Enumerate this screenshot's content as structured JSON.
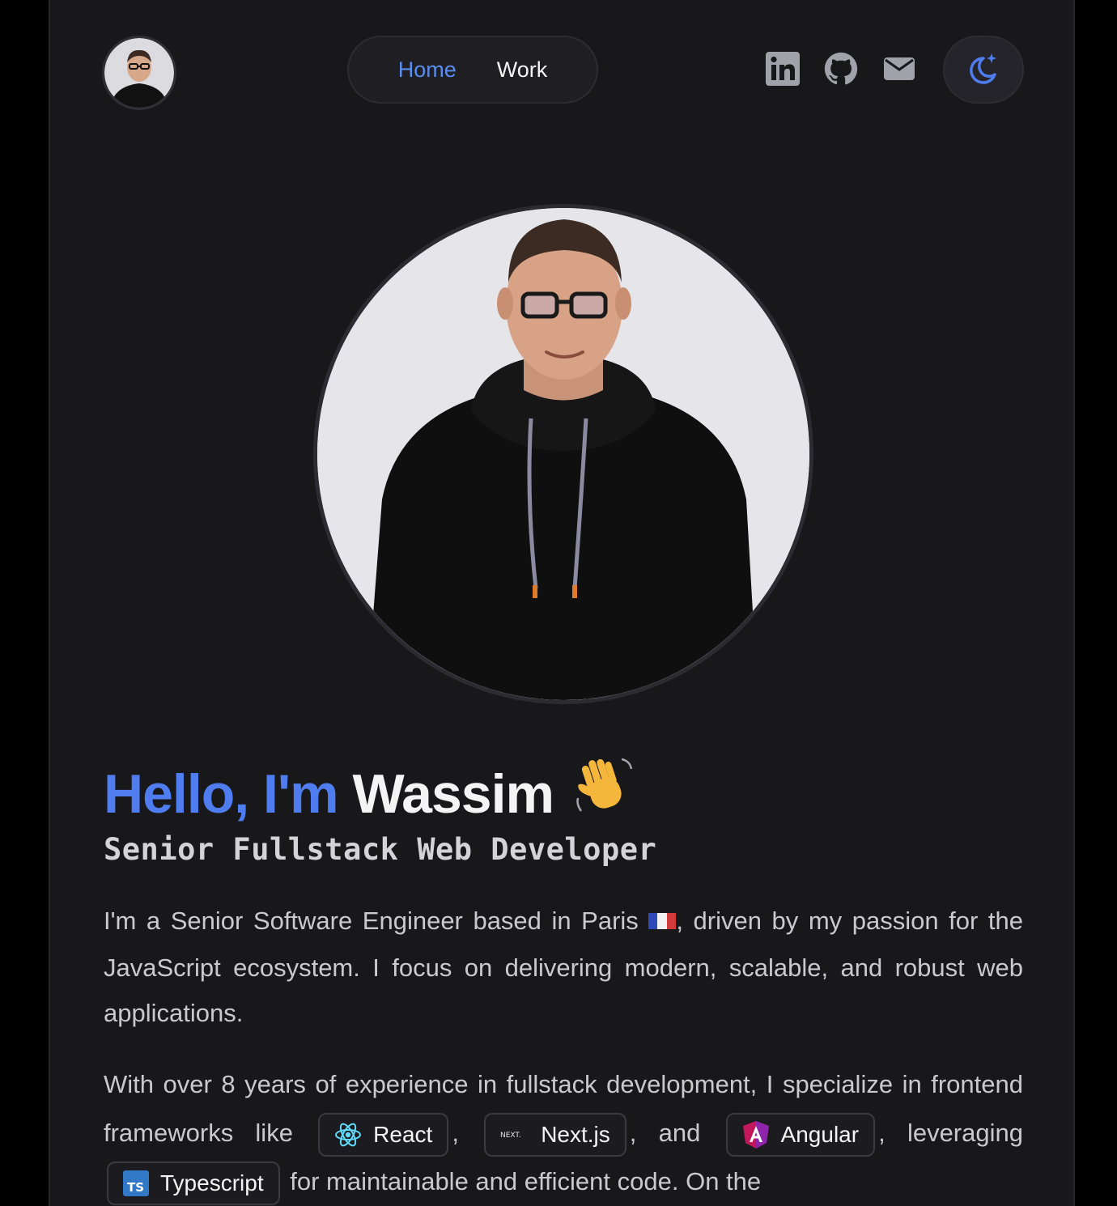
{
  "header": {
    "nav": [
      {
        "label": "Home",
        "active": true
      },
      {
        "label": "Work",
        "active": false
      }
    ],
    "socials": [
      "linkedin-icon",
      "github-icon",
      "mail-icon"
    ],
    "theme_toggle_icon": "moon-sparkle-icon"
  },
  "hero": {
    "greeting": "Hello, I'm",
    "name": "Wassim",
    "wave_emoji": "👋",
    "subtitle": "Senior Fullstack Web Developer",
    "para1": {
      "before_flag": "I'm a Senior Software Engineer based in Paris",
      "after_flag": ", driven by my passion for the JavaScript ecosystem. I focus on delivering modern, scalable, and robust web applications."
    },
    "para2": {
      "text1": "With over 8 years of experience in fullstack development, I specialize in frontend frameworks like",
      "chip_react": "React",
      "sep1": ",",
      "chip_next": "Next.js",
      "sep2": ", and",
      "chip_angular": "Angular",
      "sep3": ",",
      "text2": "leveraging",
      "chip_ts": "Typescript",
      "text3": "for maintainable and efficient code. On the"
    }
  },
  "colors": {
    "accent": "#4f7df0",
    "background": "#18181b"
  }
}
